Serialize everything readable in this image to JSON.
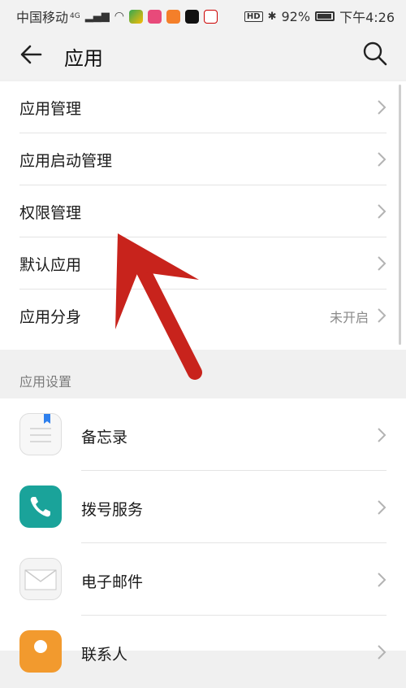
{
  "status_bar": {
    "carrier": "中国移动",
    "network": "4G",
    "bluetooth": "✱",
    "battery": "92%",
    "time": "下午4:26",
    "hd": "HD"
  },
  "header": {
    "title": "应用",
    "back_icon": "arrow-left-icon",
    "search_icon": "search-icon"
  },
  "settings": [
    {
      "label": "应用管理",
      "value": ""
    },
    {
      "label": "应用启动管理",
      "value": ""
    },
    {
      "label": "权限管理",
      "value": ""
    },
    {
      "label": "默认应用",
      "value": ""
    },
    {
      "label": "应用分身",
      "value": "未开启"
    }
  ],
  "section": {
    "title": "应用设置"
  },
  "apps": [
    {
      "label": "备忘录",
      "icon": "notepad-icon",
      "color": "#f5f5f5"
    },
    {
      "label": "拨号服务",
      "icon": "phone-icon",
      "color": "#1aa39a"
    },
    {
      "label": "电子邮件",
      "icon": "mail-icon",
      "color": "#f5f5f5"
    },
    {
      "label": "联系人",
      "icon": "contacts-icon",
      "color": "#f29a2e"
    }
  ],
  "colors": {
    "arrow": "#c8231c",
    "background": "#f0f0f0"
  }
}
